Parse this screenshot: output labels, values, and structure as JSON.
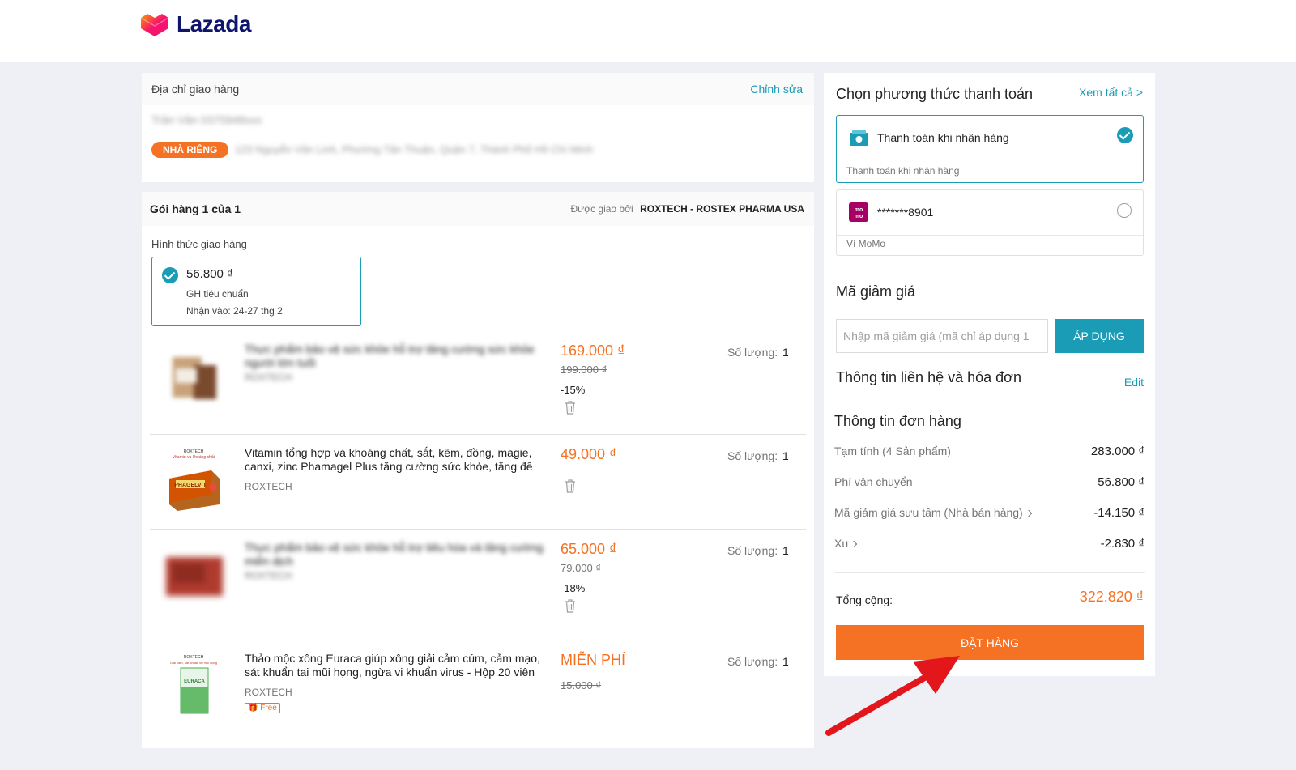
{
  "brand": {
    "name": "Lazada",
    "colors": {
      "accent": "#f57224",
      "link": "#1a9cb7",
      "navy": "#0f146d"
    }
  },
  "address": {
    "title": "Địa chỉ giao hàng",
    "edit_label": "Chỉnh sửa",
    "name_phone": "Trần Văn 0375948xxx",
    "tag": "NHÀ RIÊNG",
    "line": "123 Nguyễn Văn Linh, Phường Tân Thuận, Quận 7, Thành Phố Hồ Chí Minh"
  },
  "package": {
    "title": "Gói hàng 1 của 1",
    "delivered_by_label": "Được giao bởi",
    "seller": "ROXTECH - ROSTEX PHARMA USA",
    "shipping_label": "Hình thức giao hàng",
    "shipping": {
      "fee": "56.800 ₫",
      "type": "GH tiêu chuẩn",
      "eta": "Nhận vào: 24-27 thg 2"
    },
    "qty_label": "Số lượng:",
    "items": [
      {
        "name": "Thực phẩm bảo vệ sức khỏe hỗ trợ tăng cường sức khỏe người lớn tuổi",
        "brand": "ROXTECH",
        "price": "169.000 ₫",
        "old_price": "199.000 ₫",
        "discount": "-15%",
        "qty": "1"
      },
      {
        "name": "Vitamin tổng hợp và khoáng chất, sắt, kẽm, đồng, magie, canxi, zinc Phamagel Plus tăng cường sức khỏe, tăng đề",
        "brand": "ROXTECH",
        "price": "49.000 ₫",
        "qty": "1",
        "thumb_label": "PHAGELVIT"
      },
      {
        "name": "Thực phẩm bảo vệ sức khỏe hỗ trợ tiêu hóa và tăng cường miễn dịch",
        "brand": "ROXTECH",
        "price": "65.000 ₫",
        "old_price": "79.000 ₫",
        "discount": "-18%",
        "qty": "1"
      },
      {
        "name": "Thảo mộc xông Euraca giúp xông giải cảm cúm, cảm mạo, sát khuẩn tai mũi họng, ngừa vi khuẩn virus - Hộp 20 viên",
        "brand": "ROXTECH",
        "price": "MIỄN PHÍ",
        "old_price": "15.000 ₫",
        "qty": "1",
        "free_tag": "Free"
      }
    ]
  },
  "payment": {
    "title": "Chọn phương thức thanh toán",
    "see_all": "Xem tất cả >",
    "options": [
      {
        "name": "Thanh toán khi nhận hàng",
        "sub": "Thanh toán khi nhận hàng",
        "icon": "cash-icon",
        "selected": true
      },
      {
        "name": "*******8901",
        "sub": "Ví MoMo",
        "icon": "momo-icon",
        "selected": false
      }
    ]
  },
  "voucher": {
    "title": "Mã giảm giá",
    "placeholder": "Nhập mã giảm giá (mã chỉ áp dụng 1",
    "apply_label": "ÁP DỤNG"
  },
  "contact": {
    "title": "Thông tin liên hệ và hóa đơn",
    "edit_label": "Edit"
  },
  "summary": {
    "title": "Thông tin đơn hàng",
    "rows": [
      {
        "label": "Tạm tính (4 Sản phẩm)",
        "value": "283.000 ₫"
      },
      {
        "label": "Phí vận chuyển",
        "value": "56.800 ₫"
      },
      {
        "label": "Mã giảm giá sưu tầm (Nhà bán hàng)",
        "value": "-14.150 ₫"
      },
      {
        "label": "Xu",
        "value": "-2.830 ₫"
      }
    ],
    "total_label": "Tổng cộng:",
    "total_value": "322.820 ₫",
    "order_button": "ĐẶT HÀNG"
  }
}
